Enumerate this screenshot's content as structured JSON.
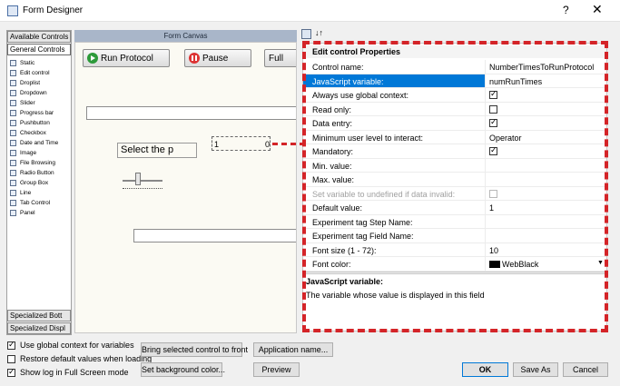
{
  "window": {
    "title": "Form Designer",
    "help_label": "?",
    "close_label": "✕"
  },
  "left": {
    "tab_available": "Available Controls",
    "tab_general": "General Controls",
    "items": [
      "Static",
      "Edit control",
      "Droplist",
      "Dropdown",
      "Slider",
      "Progress bar",
      "Pushbutton",
      "Checkbox",
      "Date and Time",
      "Image",
      "File Browsing",
      "Radio Button",
      "Group Box",
      "Line",
      "Tab Control",
      "Panel"
    ],
    "tab_specialized_bot": "Specialized Bott",
    "tab_specialized_disp": "Specialized Displ"
  },
  "canvas": {
    "header": "Form Canvas",
    "run_label": "Run Protocol",
    "pause_label": "Pause",
    "full_label": "Full",
    "static_text": "Select the p",
    "spin_left": "1",
    "spin_right": "0"
  },
  "props": {
    "sort_glyph": "↓↑",
    "category": "Edit control Properties",
    "rows": [
      {
        "name": "Control name:",
        "value": "NumberTimesToRunProtocol"
      },
      {
        "name": "JavaScript variable:",
        "value": "numRunTimes"
      },
      {
        "name": "Always use global context:",
        "value": ""
      },
      {
        "name": "Read only:",
        "value": ""
      },
      {
        "name": "Data entry:",
        "value": ""
      },
      {
        "name": "Minimum user level to interact:",
        "value": "Operator"
      },
      {
        "name": "Mandatory:",
        "value": ""
      },
      {
        "name": "Min. value:",
        "value": ""
      },
      {
        "name": "Max. value:",
        "value": ""
      },
      {
        "name": "Set variable to undefined if data invalid:",
        "value": ""
      },
      {
        "name": "Default value:",
        "value": "1"
      },
      {
        "name": "Experiment tag Step Name:",
        "value": ""
      },
      {
        "name": "Experiment tag Field Name:",
        "value": ""
      },
      {
        "name": "Font size (1 - 72):",
        "value": "10"
      },
      {
        "name": "Font color:",
        "value": "WebBlack"
      }
    ],
    "desc_title": "JavaScript variable:",
    "desc_text": "The variable whose value is displayed in this field"
  },
  "bottom": {
    "cb_global": "Use global context for variables",
    "cb_restore": "Restore default values when loading",
    "cb_log": "Show log in Full Screen mode",
    "btn_bring": "Bring selected control to front",
    "btn_bg": "Set background color...",
    "btn_app": "Application name...",
    "btn_preview": "Preview",
    "btn_ok": "OK",
    "btn_saveas": "Save As",
    "btn_cancel": "Cancel"
  },
  "colors": {
    "accent": "#0078d7",
    "highlight": "#d42428",
    "canvas_header": "#a9b6c9"
  }
}
